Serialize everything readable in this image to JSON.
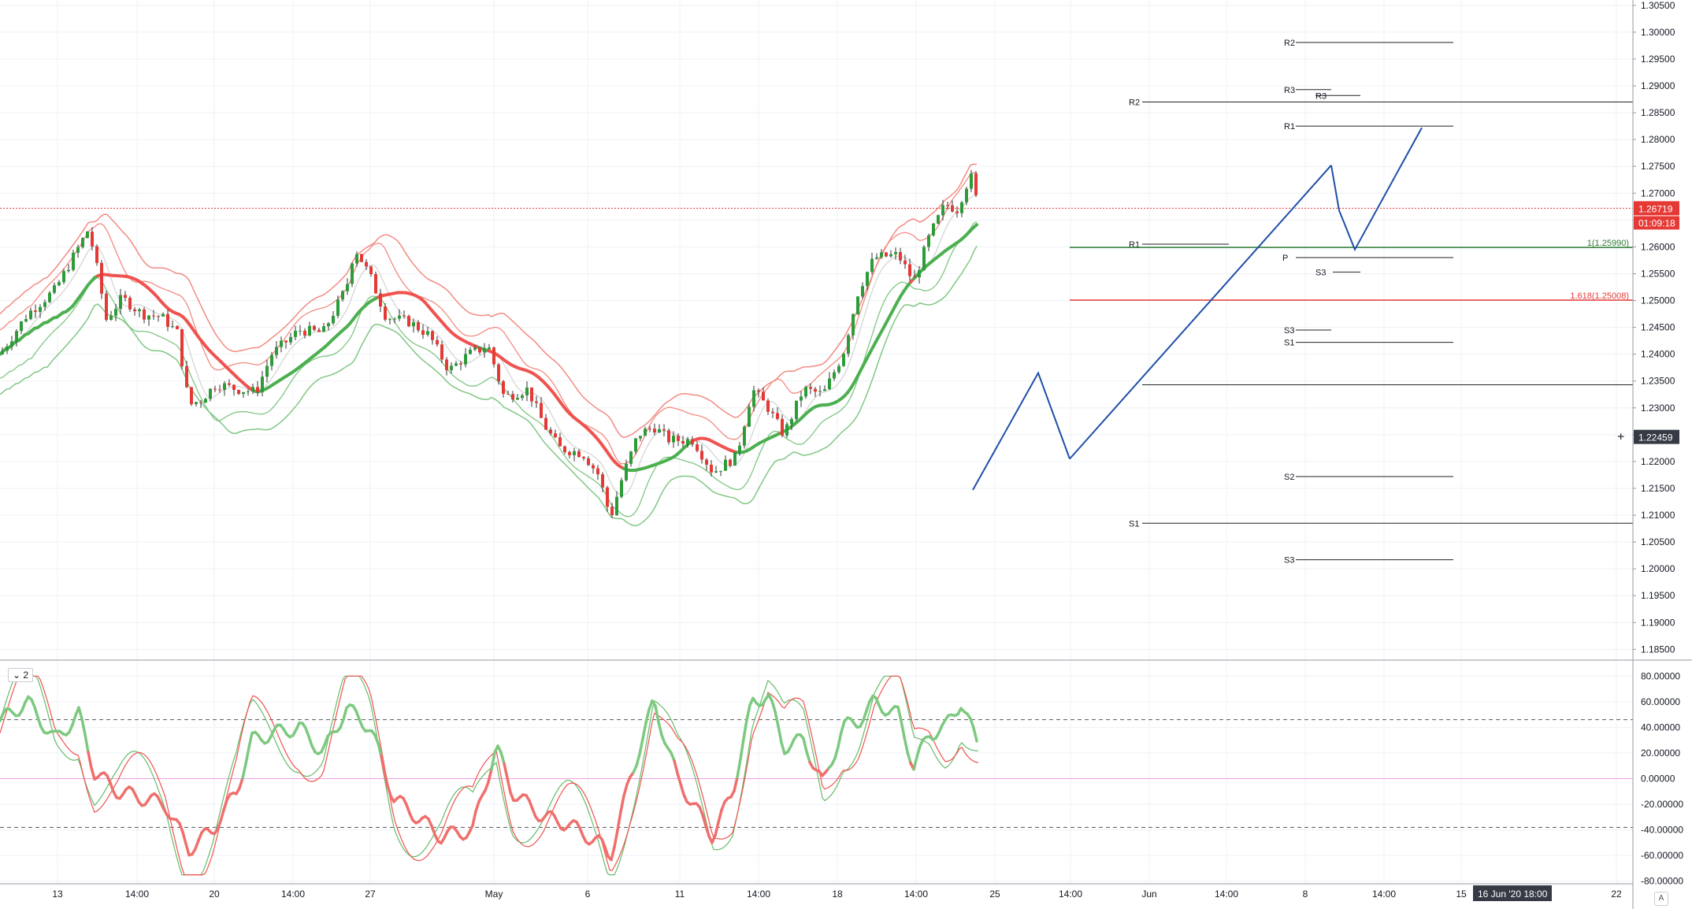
{
  "chart_data": {
    "type": "candlestick",
    "price_axis": {
      "ticks": [
        "1.30500",
        "1.30000",
        "1.29500",
        "1.29000",
        "1.28500",
        "1.28000",
        "1.27500",
        "1.27000",
        "1.26500",
        "1.26000",
        "1.25500",
        "1.25000",
        "1.24500",
        "1.24000",
        "1.23500",
        "1.23000",
        "1.22500",
        "1.22000",
        "1.21500",
        "1.21000",
        "1.20500",
        "1.20000",
        "1.19500",
        "1.19000",
        "1.18500"
      ],
      "range": [
        1.183,
        1.306
      ]
    },
    "price_tags": {
      "last_price": "1.26719",
      "countdown": "01:09:18",
      "cursor_price": "1.22459"
    },
    "time_axis": {
      "labels": [
        "13",
        "14:00",
        "20",
        "14:00",
        "27",
        "May",
        "6",
        "11",
        "14:00",
        "18",
        "14:00",
        "25",
        "14:00",
        "Jun",
        "14:00",
        "8",
        "14:00",
        "15",
        "22"
      ],
      "cursor_date": "16 Jun '20",
      "cursor_time": "18:00"
    },
    "levels": [
      {
        "label": "R2",
        "value": 1.2981
      },
      {
        "label": "R3",
        "value": 1.2893
      },
      {
        "label": "R3",
        "value": 1.2882
      },
      {
        "label": "R2",
        "value": 1.287
      },
      {
        "label": "R1",
        "value": 1.2825
      },
      {
        "label": "R1",
        "value": 1.2605
      },
      {
        "label": "P",
        "value": 1.258
      },
      {
        "label": "S3",
        "value": 1.2553
      },
      {
        "label": "S3",
        "value": 1.2445
      },
      {
        "label": "S1",
        "value": 1.2422
      },
      {
        "label": "S2",
        "value": 1.2172
      },
      {
        "label": "S1",
        "value": 1.2085
      },
      {
        "label": "S3",
        "value": 1.2017
      }
    ],
    "fib_levels": [
      {
        "label": "1(1.25990)",
        "value": 1.2599,
        "color": "#2e7d32"
      },
      {
        "label": "1.618(1.25008)",
        "value": 1.25008,
        "color": "#e53935"
      }
    ],
    "oscillator": {
      "pane_label": "2",
      "ticks": [
        "80.00000",
        "60.00000",
        "40.00000",
        "20.00000",
        "0.00000",
        "-20.00000",
        "-40.00000",
        "-60.00000",
        "-80.00000"
      ],
      "range": [
        -82,
        90
      ],
      "upper_band": 46,
      "lower_band": -38
    },
    "colors": {
      "up": "#26a69a",
      "bull_body": "#2e9b3a",
      "bear_body": "#e53935",
      "ema_green": "#4caf50",
      "ema_red": "#ef5350",
      "band_red": "#f28b82",
      "band_green": "#81c784",
      "pattern": "#1e4fa8",
      "last_price": "#e53935",
      "grid": "#eef1f6"
    },
    "price_path": [
      {
        "t": 0,
        "p": 1.24
      },
      {
        "t": 35,
        "p": 1.2475
      },
      {
        "t": 70,
        "p": 1.252
      },
      {
        "t": 100,
        "p": 1.26
      },
      {
        "t": 112,
        "p": 1.2632
      },
      {
        "t": 120,
        "p": 1.2585
      },
      {
        "t": 135,
        "p": 1.2465
      },
      {
        "t": 155,
        "p": 1.2505
      },
      {
        "t": 180,
        "p": 1.2475
      },
      {
        "t": 205,
        "p": 1.247
      },
      {
        "t": 225,
        "p": 1.244
      },
      {
        "t": 240,
        "p": 1.2305
      },
      {
        "t": 255,
        "p": 1.2315
      },
      {
        "t": 275,
        "p": 1.2345
      },
      {
        "t": 300,
        "p": 1.2335
      },
      {
        "t": 325,
        "p": 1.233
      },
      {
        "t": 345,
        "p": 1.24
      },
      {
        "t": 380,
        "p": 1.2445
      },
      {
        "t": 410,
        "p": 1.244
      },
      {
        "t": 440,
        "p": 1.2525
      },
      {
        "t": 450,
        "p": 1.26
      },
      {
        "t": 470,
        "p": 1.2545
      },
      {
        "t": 490,
        "p": 1.247
      },
      {
        "t": 520,
        "p": 1.246
      },
      {
        "t": 545,
        "p": 1.2435
      },
      {
        "t": 570,
        "p": 1.237
      },
      {
        "t": 595,
        "p": 1.24
      },
      {
        "t": 620,
        "p": 1.2415
      },
      {
        "t": 640,
        "p": 1.232
      },
      {
        "t": 670,
        "p": 1.2335
      },
      {
        "t": 690,
        "p": 1.227
      },
      {
        "t": 710,
        "p": 1.2225
      },
      {
        "t": 740,
        "p": 1.2215
      },
      {
        "t": 760,
        "p": 1.2175
      },
      {
        "t": 775,
        "p": 1.2095
      },
      {
        "t": 790,
        "p": 1.217
      },
      {
        "t": 810,
        "p": 1.225
      },
      {
        "t": 830,
        "p": 1.2265
      },
      {
        "t": 850,
        "p": 1.224
      },
      {
        "t": 880,
        "p": 1.224
      },
      {
        "t": 905,
        "p": 1.218
      },
      {
        "t": 935,
        "p": 1.221
      },
      {
        "t": 955,
        "p": 1.2335
      },
      {
        "t": 975,
        "p": 1.23
      },
      {
        "t": 995,
        "p": 1.225
      },
      {
        "t": 1020,
        "p": 1.2335
      },
      {
        "t": 1045,
        "p": 1.2325
      },
      {
        "t": 1070,
        "p": 1.24
      },
      {
        "t": 1090,
        "p": 1.252
      },
      {
        "t": 1110,
        "p": 1.258
      },
      {
        "t": 1140,
        "p": 1.2585
      },
      {
        "t": 1160,
        "p": 1.2535
      },
      {
        "t": 1180,
        "p": 1.262
      },
      {
        "t": 1200,
        "p": 1.268
      },
      {
        "t": 1215,
        "p": 1.267
      },
      {
        "t": 1232,
        "p": 1.2735
      },
      {
        "t": 1242,
        "p": 1.2672
      }
    ],
    "oscillator_path": [
      {
        "t": 0,
        "v": 45
      },
      {
        "t": 35,
        "v": 60
      },
      {
        "t": 70,
        "v": 30
      },
      {
        "t": 100,
        "v": 50
      },
      {
        "t": 120,
        "v": 5
      },
      {
        "t": 150,
        "v": -10
      },
      {
        "t": 180,
        "v": -15
      },
      {
        "t": 210,
        "v": -20
      },
      {
        "t": 240,
        "v": -55
      },
      {
        "t": 270,
        "v": -40
      },
      {
        "t": 300,
        "v": -10
      },
      {
        "t": 320,
        "v": 30
      },
      {
        "t": 345,
        "v": 35
      },
      {
        "t": 380,
        "v": 40
      },
      {
        "t": 410,
        "v": 20
      },
      {
        "t": 440,
        "v": 55
      },
      {
        "t": 470,
        "v": 40
      },
      {
        "t": 500,
        "v": -15
      },
      {
        "t": 530,
        "v": -30
      },
      {
        "t": 560,
        "v": -45
      },
      {
        "t": 600,
        "v": -40
      },
      {
        "t": 630,
        "v": 25
      },
      {
        "t": 650,
        "v": -10
      },
      {
        "t": 690,
        "v": -30
      },
      {
        "t": 720,
        "v": -35
      },
      {
        "t": 760,
        "v": -50
      },
      {
        "t": 775,
        "v": -60
      },
      {
        "t": 800,
        "v": 0
      },
      {
        "t": 830,
        "v": 60
      },
      {
        "t": 860,
        "v": 0
      },
      {
        "t": 880,
        "v": -20
      },
      {
        "t": 905,
        "v": -45
      },
      {
        "t": 930,
        "v": -10
      },
      {
        "t": 955,
        "v": 60
      },
      {
        "t": 975,
        "v": 65
      },
      {
        "t": 995,
        "v": 25
      },
      {
        "t": 1020,
        "v": 30
      },
      {
        "t": 1045,
        "v": -5
      },
      {
        "t": 1070,
        "v": 40
      },
      {
        "t": 1090,
        "v": 45
      },
      {
        "t": 1110,
        "v": 60
      },
      {
        "t": 1140,
        "v": 50
      },
      {
        "t": 1160,
        "v": 10
      },
      {
        "t": 1180,
        "v": 35
      },
      {
        "t": 1200,
        "v": 40
      },
      {
        "t": 1220,
        "v": 60
      },
      {
        "t": 1242,
        "v": 25
      }
    ]
  }
}
